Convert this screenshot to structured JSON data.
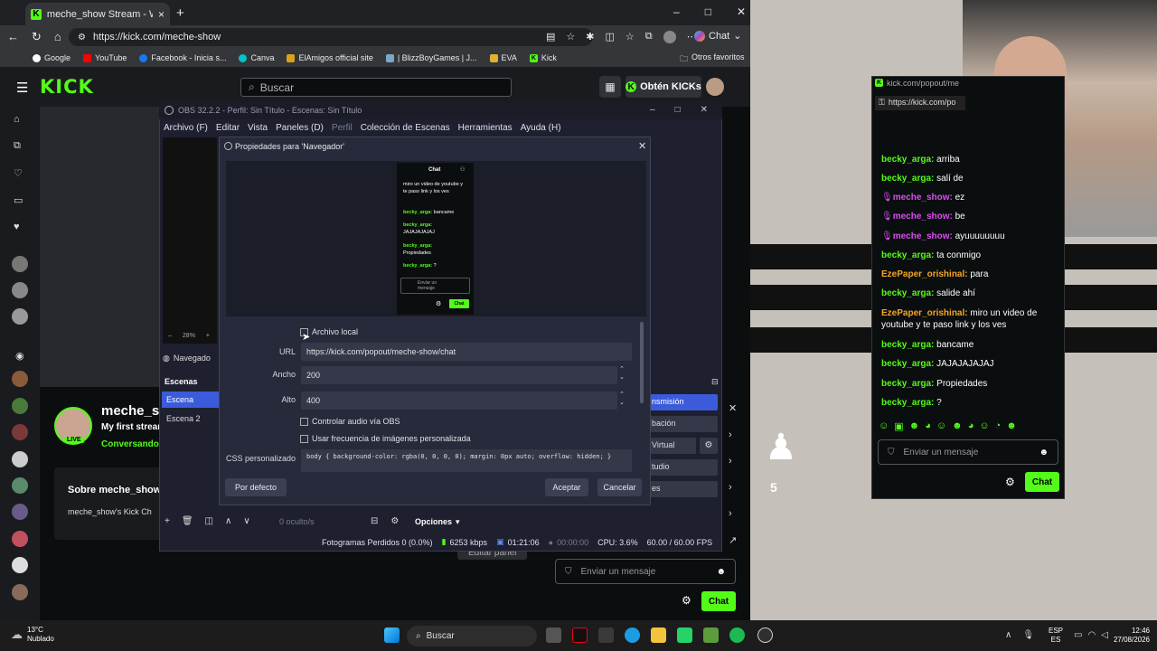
{
  "browser": {
    "tab_title": "meche_show Stream - Watch Live",
    "url": "https://kick.com/meche-show",
    "copilot_label": "Chat",
    "bookmarks": [
      "Google",
      "YouTube",
      "Facebook - Inicia s...",
      "Canva",
      "ElAmigos official site",
      "| BlizzBoyGames | J...",
      "EVA",
      "Kick"
    ],
    "other_favorites": "Otros favoritos"
  },
  "kick": {
    "logo": "KICK",
    "search_placeholder": "Buscar",
    "get_kicks": "Obtén KICKs",
    "channel_name": "meche_sh",
    "stream_title": "My first stream",
    "category": "Conversando",
    "live_badge": "LIVE",
    "about_title": "Sobre meche_show",
    "about_text": "meche_show's Kick Ch",
    "chat_placeholder": "Enviar un mensaje",
    "chat_button": "Chat",
    "edit_panel": "Editar panel"
  },
  "obs": {
    "title": "OBS 32.2.2 - Perfil: Sin Título - Escenas: Sin Título",
    "menu": [
      "Archivo (F)",
      "Editar",
      "Vista",
      "Paneles (D)",
      "Perfil",
      "Colección de Escenas",
      "Herramientas",
      "Ayuda (H)"
    ],
    "scenes_header": "Escenas",
    "scenes": [
      "Escena",
      "Escena 2"
    ],
    "source_label": "Navegado",
    "hidden_count": "0 oculto/s",
    "options": "Opciones",
    "controls": [
      "nsmisión",
      "bación",
      "Virtual",
      "tudio",
      "es"
    ],
    "status": {
      "dropped_frames": "Fotogramas Perdidos 0 (0.0%)",
      "bitrate": "6253 kbps",
      "stream_time": "01:21:06",
      "rec_time": "00:00:00",
      "cpu": "CPU: 3.6%",
      "fps": "60.00 / 60.00 FPS"
    }
  },
  "dialog": {
    "title": "Propiedades para 'Navegador'",
    "local_file": "Archivo local",
    "url_label": "URL",
    "url_value": "https://kick.com/popout/meche-show/chat",
    "width_label": "Ancho",
    "width_value": "200",
    "height_label": "Alto",
    "height_value": "400",
    "control_audio": "Controlar audio vía OBS",
    "custom_fps": "Usar frecuencia de imágenes personalizada",
    "css_label": "CSS personalizado",
    "css_value": "body { background-color: rgba(0, 0, 0, 0); margin: 0px auto; overflow: hidden; }",
    "defaults": "Por defecto",
    "accept": "Aceptar",
    "cancel": "Cancelar",
    "zoom": "28%",
    "preview": {
      "header": "Chat",
      "lines": [
        {
          "user": "",
          "text": "miro un video de youtube y te paso link y los ves"
        },
        {
          "user": "becky_arga:",
          "text": "bancame"
        },
        {
          "user": "becky_arga:",
          "text": "JAJAJAJAJAJ"
        },
        {
          "user": "becky_arga:",
          "text": "Propiedades"
        },
        {
          "user": "becky_arga:",
          "text": "?"
        }
      ],
      "input": "Enviar un mensaje",
      "button": "Chat"
    }
  },
  "popout": {
    "window_url": "kick.com/popout/me",
    "address": "https://kick.com/po",
    "messages": [
      {
        "user": "becky_arga:",
        "color": "green",
        "text": "arriba"
      },
      {
        "user": "becky_arga:",
        "color": "green",
        "text": "salí de"
      },
      {
        "user": "meche_show:",
        "color": "purple",
        "text": "ez"
      },
      {
        "user": "meche_show:",
        "color": "purple",
        "text": "be"
      },
      {
        "user": "meche_show:",
        "color": "purple",
        "text": "ayuuuuuuuu"
      },
      {
        "user": "becky_arga:",
        "color": "green",
        "text": "ta conmigo"
      },
      {
        "user": "EzePaper_orishinal:",
        "color": "orange",
        "text": "para"
      },
      {
        "user": "becky_arga:",
        "color": "green",
        "text": "salide ahí"
      },
      {
        "user": "EzePaper_orishinal:",
        "color": "orange",
        "text": "miro un video de youtube y te paso link y los ves"
      },
      {
        "user": "becky_arga:",
        "color": "green",
        "text": "bancame"
      },
      {
        "user": "becky_arga:",
        "color": "green",
        "text": "JAJAJAJAJAJ"
      },
      {
        "user": "becky_arga:",
        "color": "green",
        "text": "Propiedades"
      },
      {
        "user": "becky_arga:",
        "color": "green",
        "text": "?"
      }
    ],
    "input_placeholder": "Enviar un mensaje",
    "chat_button": "Chat"
  },
  "overlay_number": "5",
  "taskbar": {
    "weather_temp": "13°C",
    "weather_desc": "Nublado",
    "search": "Buscar",
    "lang_top": "ESP",
    "lang_bottom": "ES",
    "time": "12:46",
    "date": "27/08/2026"
  },
  "colors": {
    "kick_green": "#53fc18",
    "obs_dialog": "#272a3b",
    "accent_blue": "#3b5bdb"
  }
}
